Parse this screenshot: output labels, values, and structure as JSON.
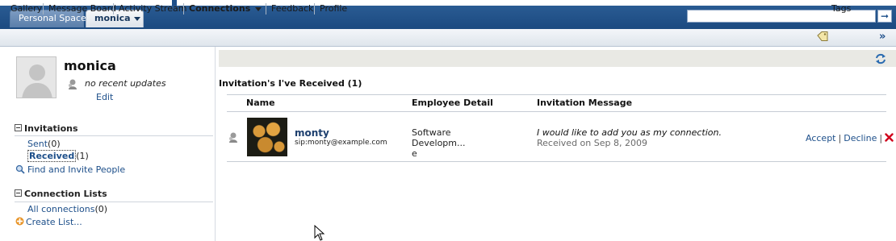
{
  "tabs": {
    "personal_space": "Personal Space",
    "monica": "monica"
  },
  "toolbar": {
    "items": [
      "Gallery",
      "Message Board",
      "Activity Stream",
      "Connections",
      "Feedback",
      "Profile"
    ],
    "tags": "Tags",
    "more": "»"
  },
  "profile": {
    "name": "monica",
    "status": "no recent updates",
    "edit": "Edit"
  },
  "invitations": {
    "heading": "Invitations",
    "sent_label": "Sent",
    "sent_count": "(0)",
    "received_label": "Received",
    "received_count": "(1)",
    "find": "Find and Invite People"
  },
  "connection_lists": {
    "heading": "Connection Lists",
    "all_label": "All connections",
    "all_count": "(0)",
    "create": "Create List..."
  },
  "main": {
    "title": "Invitation's I've Received (1)",
    "columns": [
      "Name",
      "Employee Detail",
      "Invitation Message"
    ],
    "row": {
      "name": "monty",
      "sip": "sip:monty@example.com",
      "employee_detail_line1": "Software Developm...",
      "employee_detail_line2": "e",
      "message": "I would like to add you as my connection.",
      "received_on": "Received on Sep 8, 2009",
      "accept": "Accept",
      "decline": "Decline"
    }
  },
  "colors": {
    "link": "#1d4f8a",
    "header_band": "#1b4a80",
    "delete_red": "#d0021b"
  }
}
